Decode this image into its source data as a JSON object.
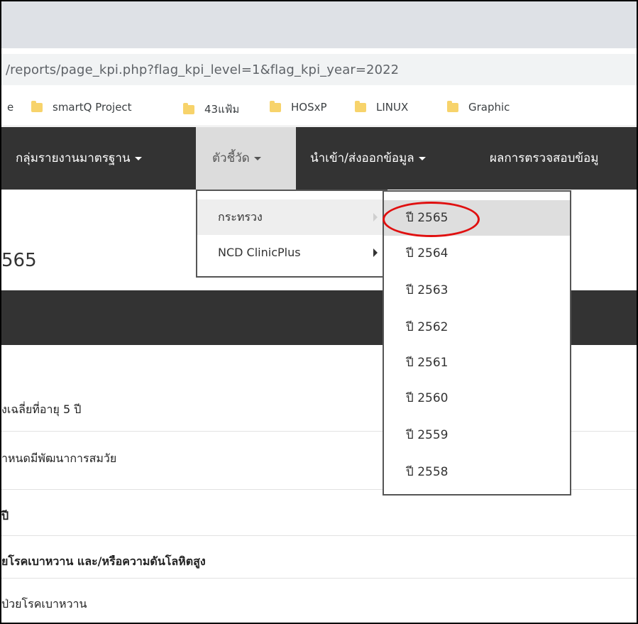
{
  "browser": {
    "url": "/reports/page_kpi.php?flag_kpi_level=1&flag_kpi_year=2022",
    "bookmarks": {
      "partial": "e",
      "items": [
        "smartQ Project",
        "43แฟ้ม",
        "HOSxP",
        "LINUX",
        "Graphic"
      ]
    }
  },
  "navbar": {
    "items": [
      "กลุ่มรายงานมาตรฐาน",
      "ตัวชี้วัด",
      "นำเข้า/ส่งออกข้อมูล",
      "ผลการตรวจสอบข้อมู"
    ]
  },
  "menu": {
    "level1": [
      "กระทรวง",
      "NCD ClinicPlus"
    ],
    "level2": [
      "ปี 2565",
      "ปี 2564",
      "ปี 2563",
      "ปี 2562",
      "ปี 2561",
      "ปี 2560",
      "ปี 2559",
      "ปี 2558"
    ]
  },
  "page": {
    "title": "565",
    "rows": [
      "งเฉลี่ยที่อายุ 5 ปี",
      "ำหนดมีพัฒนาการสมวัย",
      "ปี",
      "ยโรคเบาหวาน และ/หรือความดันโลหิตสูง",
      "ป่วยโรคเบาหวาน"
    ]
  },
  "colors": {
    "navbar": "#333333",
    "highlight_circle": "#e01010",
    "folder": "#f7d36b"
  }
}
